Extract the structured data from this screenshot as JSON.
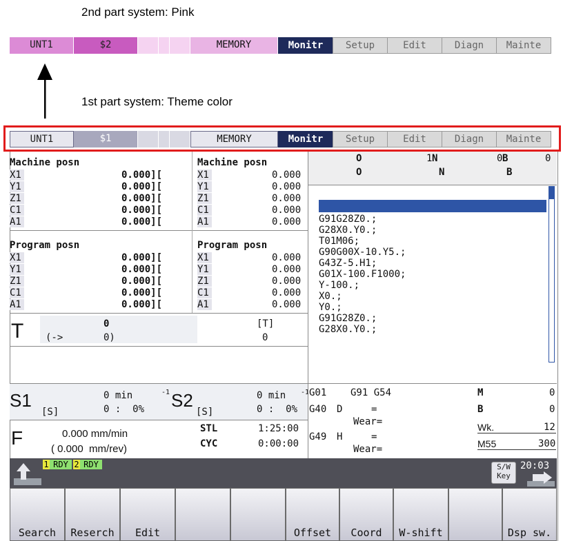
{
  "captions": {
    "second_system": "2nd part system: Pink",
    "first_system": "1st part system: Theme color"
  },
  "bar2": {
    "unit": "UNT1",
    "system": "$2",
    "mode": "MEMORY",
    "tabs": [
      "Monitr",
      "Setup",
      "Edit",
      "Diagn",
      "Mainte"
    ]
  },
  "bar1": {
    "unit": "UNT1",
    "system": "$1",
    "mode": "MEMORY",
    "tabs": [
      "Monitr",
      "Setup",
      "Edit",
      "Diagn",
      "Mainte"
    ]
  },
  "machine_posn": {
    "title": "Machine posn",
    "rows": [
      {
        "axis": "X1",
        "val": "0.000][",
        "val2": "0.000"
      },
      {
        "axis": "Y1",
        "val": "0.000][",
        "val2": "0.000"
      },
      {
        "axis": "Z1",
        "val": "0.000][",
        "val2": "0.000"
      },
      {
        "axis": "C1",
        "val": "0.000][",
        "val2": "0.000"
      },
      {
        "axis": "A1",
        "val": "0.000][",
        "val2": "0.000"
      }
    ]
  },
  "program_posn": {
    "title": "Program posn",
    "rows": [
      {
        "axis": "X1",
        "val": "0.000][",
        "val2": "0.000"
      },
      {
        "axis": "Y1",
        "val": "0.000][",
        "val2": "0.000"
      },
      {
        "axis": "Z1",
        "val": "0.000][",
        "val2": "0.000"
      },
      {
        "axis": "C1",
        "val": "0.000][",
        "val2": "0.000"
      },
      {
        "axis": "A1",
        "val": "0.000][",
        "val2": "0.000"
      }
    ]
  },
  "prog_header": {
    "o_label": "O",
    "o_val": "1",
    "n_label": "N",
    "n_val": "0",
    "b_label": "B",
    "b_val": "0",
    "o2": "O",
    "n2": "N",
    "b2": "B"
  },
  "program": [
    "G91G28Z0.;",
    "G28X0.Y0.;",
    "T01M06;",
    "G90G00X-10.Y5.;",
    "G43Z-5.H1;",
    "G01X-100.F1000;",
    "Y-100.;",
    "X0.;",
    "Y0.;",
    "G91G28Z0.;",
    "G28X0.Y0.;"
  ],
  "tool": {
    "label": "T",
    "value": "0",
    "arrow": "(->",
    "paren": "0)",
    "t_bracket": "[T]",
    "t_val": "0"
  },
  "spindle": {
    "s1": "S1",
    "s1_bracket": "[S]",
    "s1_speed": "0 min",
    "s1_pct": "0 :  0%",
    "s2": "S2",
    "s2_bracket": "[S]",
    "s2_speed": "0 min",
    "s2_pct": "0 :  0%"
  },
  "feed": {
    "label": "F",
    "rate": "0.000 mm/min",
    "rev": "( 0.000  mm/rev)",
    "stl_label": "STL",
    "stl_val": "1:25:00",
    "cyc_label": "CYC",
    "cyc_val": "0:00:00"
  },
  "modal": {
    "g1": "G01",
    "g2": "G91 G54",
    "g3": "G40",
    "d": "D",
    "eq1": "=",
    "wear1": "Wear=",
    "g4": "G49",
    "h": "H",
    "eq2": "=",
    "wear2": "Wear=",
    "m_label": "M",
    "m_val": "0",
    "b_label": "B",
    "b_val": "0",
    "wk_label": "Wk.",
    "wk_val": "12",
    "m55_label": "M55",
    "m55_val": "300"
  },
  "status": {
    "rdy1_num": "1",
    "rdy1": "RDY",
    "rdy2_num": "2",
    "rdy2": "RDY",
    "sw_key": "S/W Key",
    "time": "20:03"
  },
  "softkeys": [
    "Search",
    "Reserch",
    "Edit",
    "",
    "",
    "Offset",
    "Coord",
    "W-shift",
    "",
    "Dsp sw."
  ]
}
